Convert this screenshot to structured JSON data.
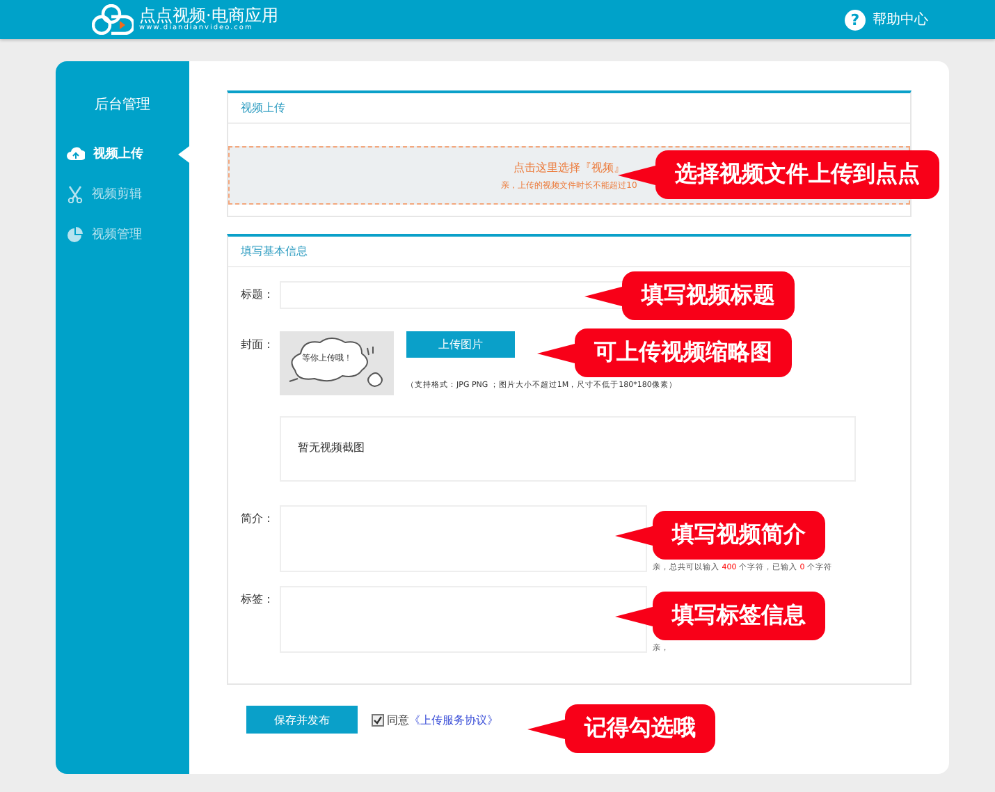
{
  "header": {
    "logo_title": "点点视频·电商应用",
    "logo_url": "www.diandianvideo.com",
    "help_icon": "?",
    "help": "帮助中心"
  },
  "sidebar": {
    "title": "后台管理",
    "items": [
      {
        "label": "视频上传",
        "kind": "cloud",
        "selected": true
      },
      {
        "label": "视频剪辑",
        "kind": "scissors",
        "selected": false
      },
      {
        "label": "视频管理",
        "kind": "pie",
        "selected": false
      }
    ]
  },
  "upload_panel": {
    "title": "视频上传",
    "prompt": "点击这里选择『视频』",
    "note": "亲，上传的视频文件时长不能超过10"
  },
  "info_panel": {
    "title": "填写基本信息",
    "title_label": "标题：",
    "cover_label": "封面：",
    "cover_placeholder": "等你上传哦！",
    "upload_button": "上传图片",
    "cover_hint": "（支持格式：JPG PNG ；图片大小不超过1M，尺寸不低于180*180像素）",
    "screenshot_empty": "暂无视频截图",
    "intro_label": "简介：",
    "intro_hint": "亲，总共可以输入 **400** 个字符，已输入 **0** 个字符",
    "tags_label": "标签：",
    "tags_hint": "亲，"
  },
  "footer": {
    "save_button": "保存并发布",
    "agree_checked": true,
    "agree_text": "同意",
    "agreement_link": "《上传服务协议》"
  },
  "callouts": [
    {
      "text": "选择视频文件上传到点点"
    },
    {
      "text": "填写视频标题"
    },
    {
      "text": "可上传视频缩略图"
    },
    {
      "text": "填写视频简介"
    },
    {
      "text": "填写标签信息"
    },
    {
      "text": "记得勾选哦"
    }
  ]
}
